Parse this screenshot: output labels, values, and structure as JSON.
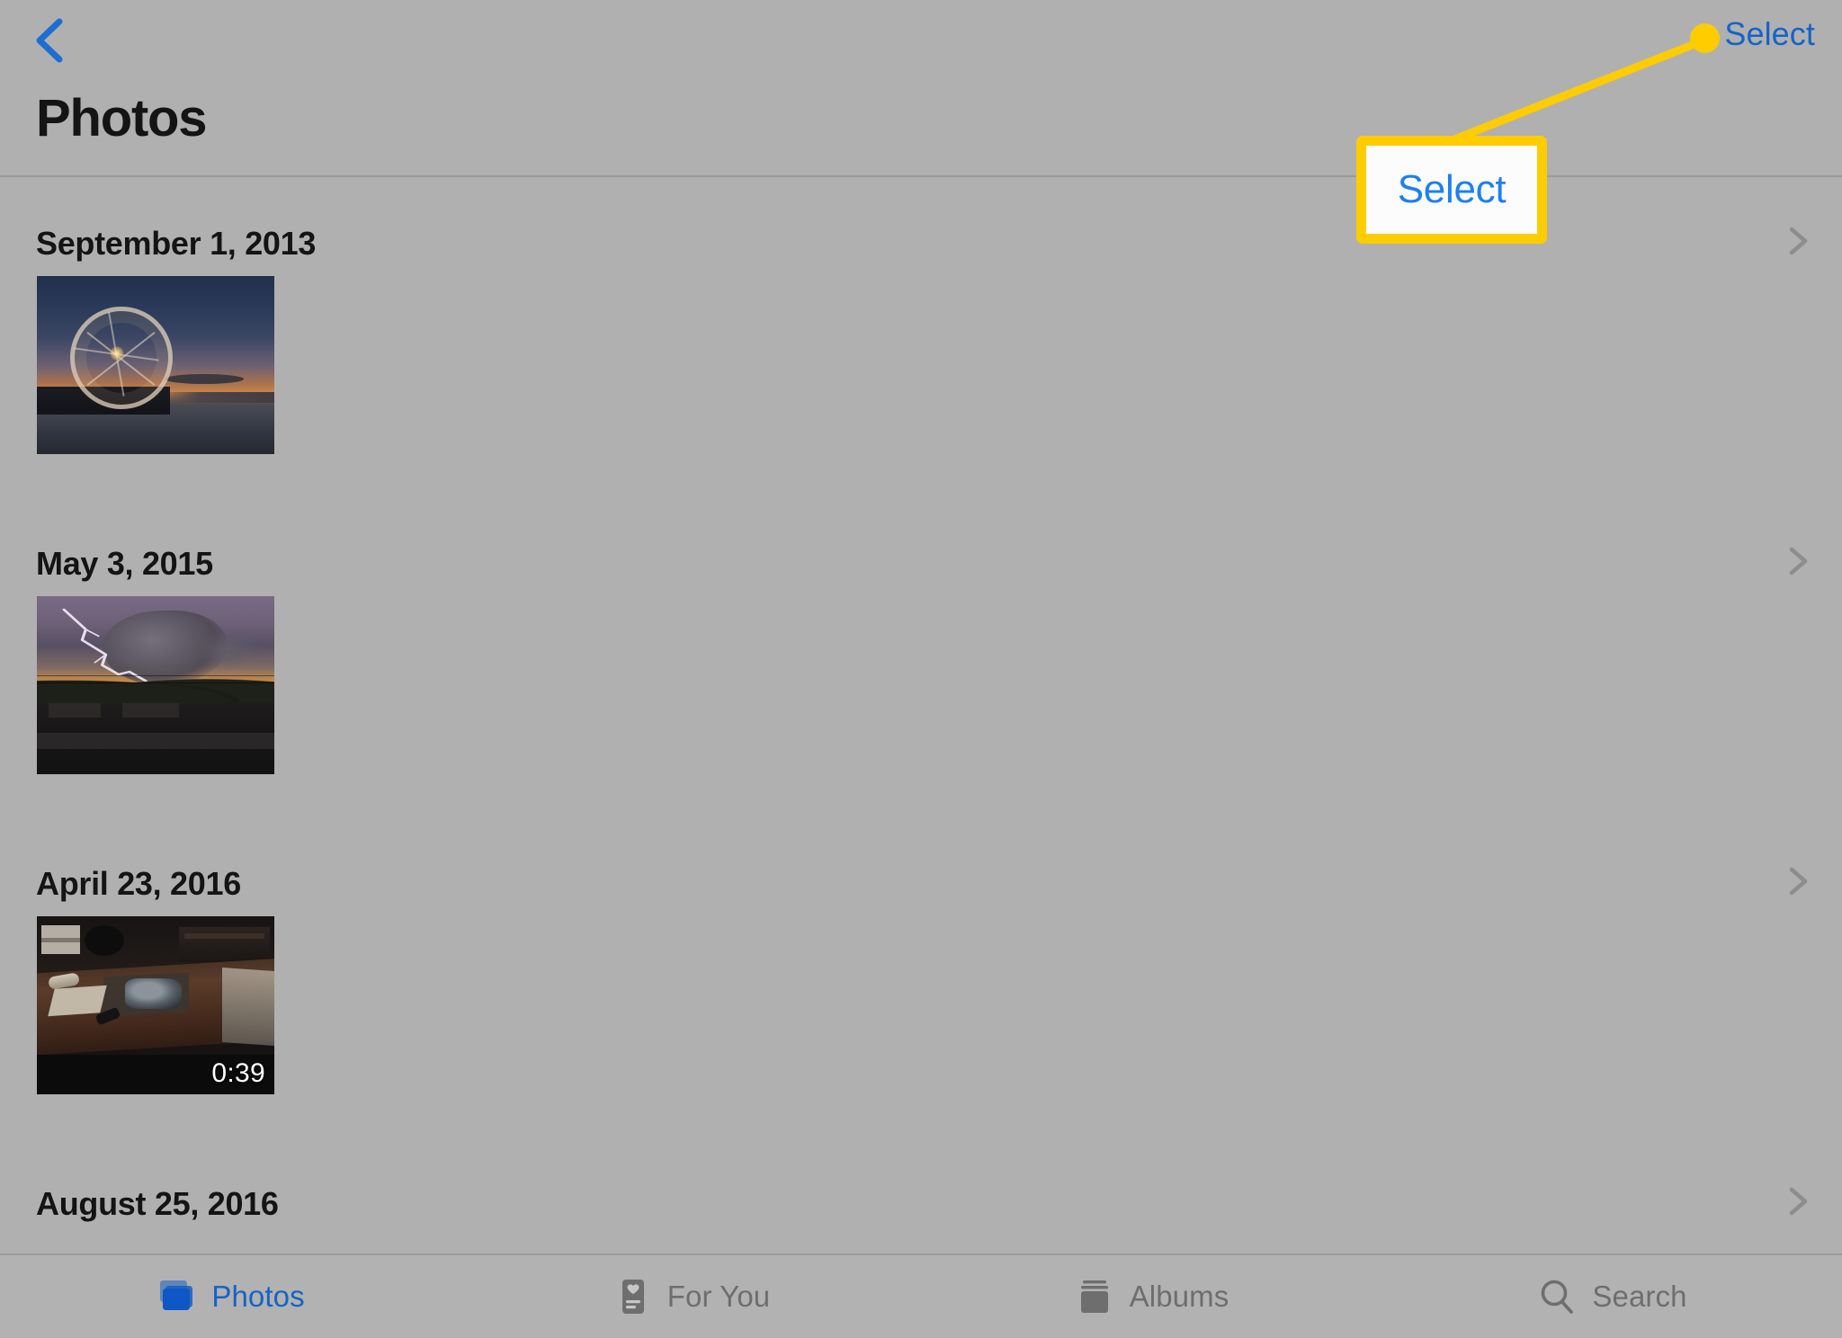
{
  "app": {
    "background_color": "#b0b0b0",
    "accent_blue": "#1464c8",
    "annotation_yellow": "#ffcc00"
  },
  "navbar": {
    "back_icon": "chevron-left-icon",
    "title": "Photos",
    "select_label": "Select"
  },
  "annotation": {
    "callout_label": "Select",
    "marker_icon": "callout-dot"
  },
  "list": {
    "groups": [
      {
        "date": "September 1, 2013",
        "chevron_icon": "chevron-right-icon",
        "items": [
          {
            "kind": "photo",
            "scene": "s-ferris",
            "name": "ferris-wheel-sunset",
            "duration": ""
          }
        ]
      },
      {
        "date": "May 3, 2015",
        "chevron_icon": "chevron-right-icon",
        "items": [
          {
            "kind": "photo",
            "scene": "s-storm",
            "name": "lightning-storm",
            "duration": ""
          }
        ]
      },
      {
        "date": "April 23, 2016",
        "chevron_icon": "chevron-right-icon",
        "items": [
          {
            "kind": "video",
            "scene": "s-desk",
            "name": "workbench-video",
            "duration": "0:39"
          }
        ]
      },
      {
        "date": "August 25, 2016",
        "chevron_icon": "chevron-right-icon",
        "items": []
      }
    ]
  },
  "tabbar": {
    "tabs": [
      {
        "label": "Photos",
        "icon": "photos-stack-icon",
        "active": true
      },
      {
        "label": "For You",
        "icon": "for-you-card-icon",
        "active": false
      },
      {
        "label": "Albums",
        "icon": "albums-stack-icon",
        "active": false
      },
      {
        "label": "Search",
        "icon": "search-icon",
        "active": false
      }
    ]
  }
}
